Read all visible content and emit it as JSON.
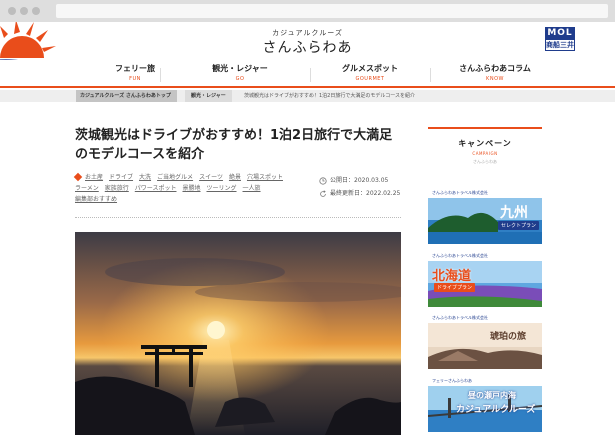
{
  "site": {
    "logo_sub": "カジュアルクルーズ",
    "logo_main": "さんふらわあ",
    "partner_top": "MOL",
    "partner_bottom": "商船三井"
  },
  "nav": [
    {
      "label": "フェリー旅",
      "sub": "FUN"
    },
    {
      "label": "観光・レジャー",
      "sub": "GO"
    },
    {
      "label": "グルメスポット",
      "sub": "GOURMET"
    },
    {
      "label": "さんふらわあコラム",
      "sub": "KNOW"
    }
  ],
  "breadcrumb": [
    "カジュアルクルーズ さんふらわあトップ",
    "観光・レジャー",
    "茨城観光はドライブがおすすめ！1泊2日旅行で大満足のモデルコースを紹介"
  ],
  "article": {
    "title": "茨城観光はドライブがおすすめ！1泊2日旅行で大満足のモデルコースを紹介",
    "tags": [
      "お土産",
      "ドライブ",
      "大洗",
      "ご当地グルメ",
      "スイーツ",
      "絶景",
      "穴場スポット",
      "ラーメン",
      "家族旅行",
      "パワースポット",
      "景勝地",
      "ツーリング",
      "一人旅",
      "編集部おすすめ"
    ],
    "published_label": "公開日：2020.03.05",
    "updated_label": "最終更新日：2022.02.25"
  },
  "sidebar": {
    "title": "キャンペーン",
    "title_en": "CAMPAIGN",
    "sub": "さんふらわあ",
    "banners": [
      {
        "brand": "さんふらわあトラベル株式会社",
        "title": "九州",
        "pill": "セレクトプラン"
      },
      {
        "brand": "さんふらわあトラベル株式会社",
        "title": "北海道",
        "pill": "ドライブプラン"
      },
      {
        "brand": "さんふらわあトラベル株式会社",
        "title": "琥珀の旅",
        "pill": ""
      },
      {
        "brand": "フェリーさんふらわあ",
        "title": "昼の瀬戸内海",
        "pill": "カジュアルクルーズ"
      }
    ]
  },
  "colors": {
    "accent": "#e94d1b",
    "brand_navy": "#1f3c8c"
  }
}
